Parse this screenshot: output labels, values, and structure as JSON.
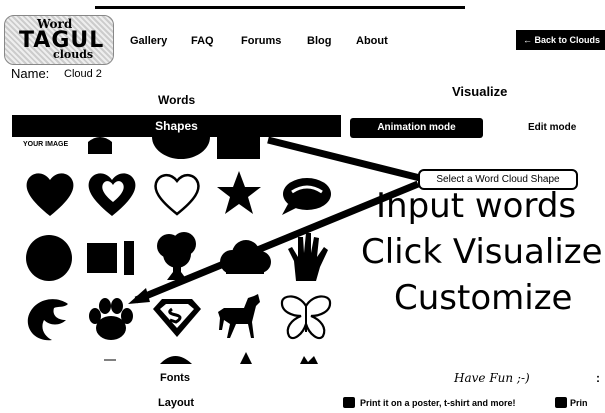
{
  "logo": {
    "line1": "Word",
    "line2": "TAGUL",
    "line3": "clouds"
  },
  "nav": {
    "items": [
      "Gallery",
      "FAQ",
      "Forums",
      "Blog",
      "About"
    ]
  },
  "back_button": "← Back to Clouds",
  "name": {
    "label": "Name:",
    "value": "Cloud 2"
  },
  "left_panel": {
    "words_header": "Words",
    "shapes_tab": "Shapes",
    "your_image": "YOUR IMAGE",
    "fonts_header": "Fonts",
    "layout_header": "Layout",
    "shapes": [
      "heart",
      "heart-outline-inner",
      "heart-outline",
      "star",
      "speech-bubble",
      "circle",
      "rectangles",
      "tree",
      "cloud",
      "hand",
      "bird",
      "paw",
      "superman",
      "horse",
      "butterfly"
    ]
  },
  "right_panel": {
    "visualize_header": "Visualize",
    "animation_mode": "Animation mode",
    "edit_mode": "Edit mode",
    "tooltip": "Select a Word Cloud Shape",
    "instruction_1": "Input words",
    "instruction_2": "Click Visualize!",
    "instruction_3": "Customize",
    "have_fun": "Have Fun ;-)",
    "print_text": "Print it on a poster, t-shirt and more!",
    "print_text_2": "Prin"
  }
}
